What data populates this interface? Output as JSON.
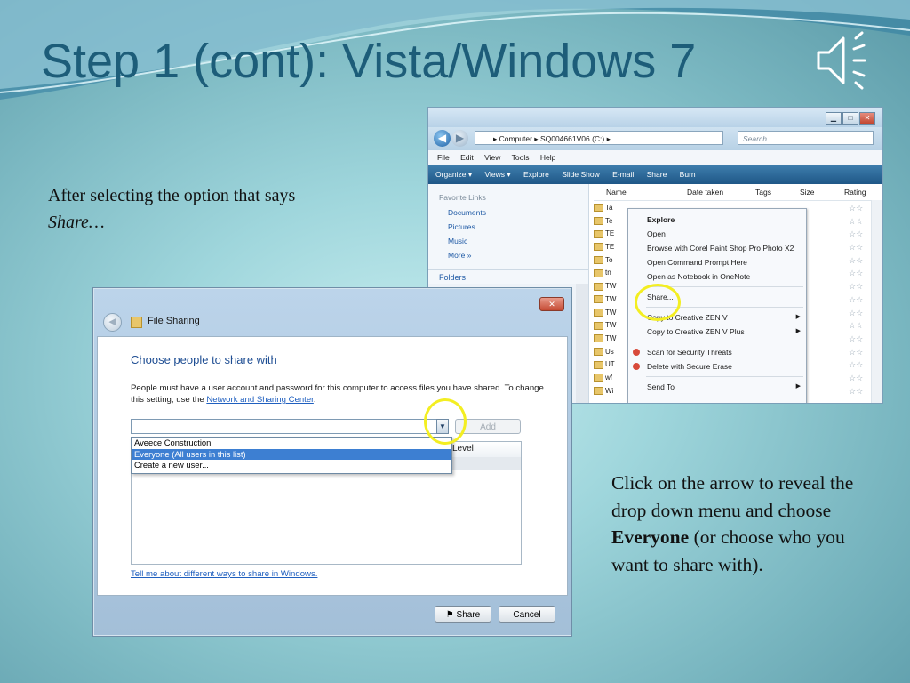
{
  "slide": {
    "title": "Step 1 (cont): Vista/Windows 7",
    "intro_line1": "After selecting the option that says",
    "intro_line2": "Share…",
    "note": {
      "part1": "Click on the arrow to reveal the drop down menu and choose ",
      "bold": "Everyone",
      "part2": " (or choose who you want to share with)."
    }
  },
  "explorer": {
    "address": "▸ Computer ▸ SQ004661V06 (C:) ▸",
    "search_placeholder": "Search",
    "menu": [
      "File",
      "Edit",
      "View",
      "Tools",
      "Help"
    ],
    "toolbar": [
      "Organize ▾",
      "Views ▾",
      "Explore",
      "Slide Show",
      "E-mail",
      "Share",
      "Burn"
    ],
    "favorite_links_label": "Favorite Links",
    "links": [
      "Documents",
      "Pictures",
      "Music",
      "More »"
    ],
    "folders_label": "Folders",
    "columns": {
      "name": "Name",
      "date": "Date taken",
      "tags": "Tags",
      "size": "Size",
      "rating": "Rating"
    },
    "rows": [
      "Ta",
      "Te",
      "TE",
      "TE",
      "To",
      "tn",
      "TW",
      "TW",
      "TW",
      "TW",
      "TW",
      "Us",
      "UT",
      "wf",
      "Wi"
    ],
    "context_menu": {
      "explore": "Explore",
      "open": "Open",
      "browse": "Browse with Corel Paint Shop Pro Photo X2",
      "cmd": "Open Command Prompt Here",
      "onenote": "Open as Notebook in OneNote",
      "share": "Share...",
      "copy_zen": "Copy to Creative ZEN V",
      "copy_zen_plus": "Copy to Creative ZEN V Plus",
      "scan": "Scan for Security Threats",
      "delete": "Delete with Secure Erase",
      "send_to": "Send To"
    }
  },
  "dialog": {
    "title": "File Sharing",
    "heading": "Choose people to share with",
    "instructions": "People must have a user account and password for this computer to access files you have shared.  To change this setting, use the ",
    "instructions_link": "Network and Sharing Center",
    "instructions_end": ".",
    "add_label": "Add",
    "dropdown_options": [
      "Aveece Construction",
      "Everyone (All users in this list)",
      "Create a new user..."
    ],
    "selected_option": "Everyone (All users in this list)",
    "permission_header": "Level",
    "help_link": "Tell me about different ways to share in Windows.",
    "share_label": "Share",
    "cancel_label": "Cancel"
  },
  "colors": {
    "title": "#1d5d79",
    "highlight_circle": "#f3ee22",
    "selected_item": "#3d7fd2",
    "link": "#1f5fbf"
  }
}
